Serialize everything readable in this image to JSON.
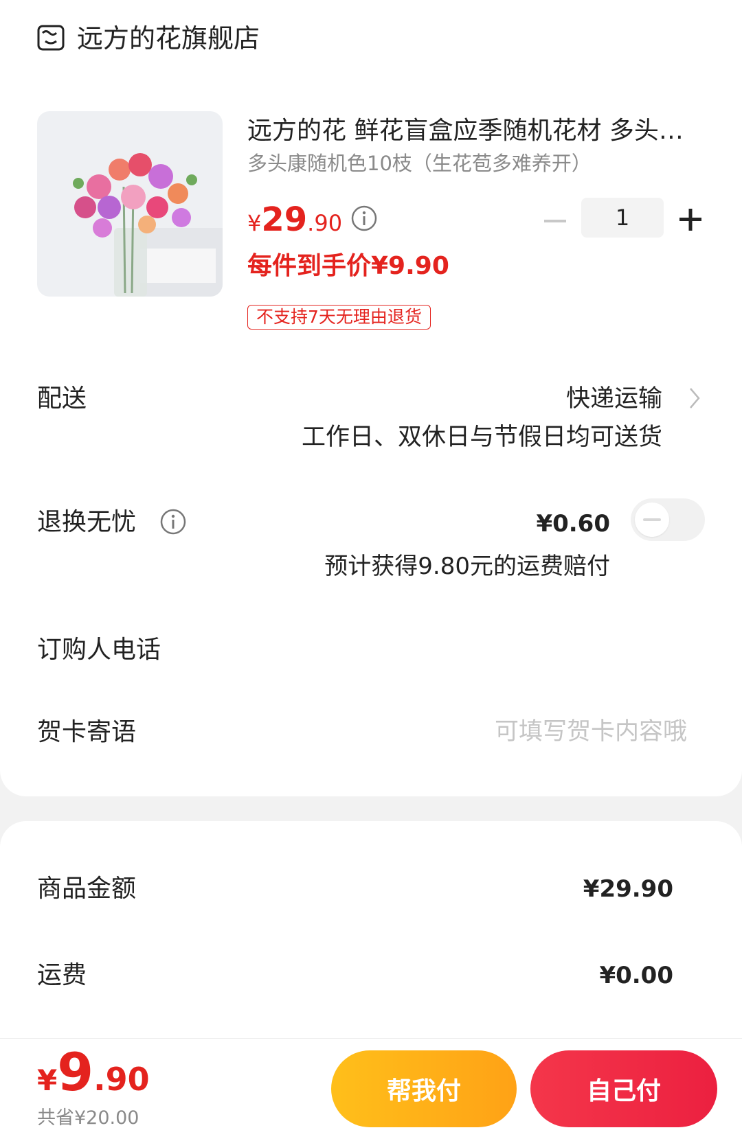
{
  "store": {
    "name": "远方的花旗舰店",
    "icon": "store-icon"
  },
  "product": {
    "title": "远方的花 鲜花盲盒应季随机花材 多头康乃馨",
    "sku": "多头康随机色10枝（生花苞多难养开）",
    "price_currency": "¥",
    "price_int": "29",
    "price_dec": ".90",
    "quantity": "1",
    "unit_price_text": "每件到手价¥9.90",
    "return_tag": "不支持7天无理由退货"
  },
  "delivery": {
    "label": "配送",
    "method": "快递运输",
    "note": "工作日、双休日与节假日均可送货"
  },
  "insurance": {
    "label": "退换无忧",
    "price": "¥0.60",
    "note": "预计获得9.80元的运费赔付",
    "enabled": false
  },
  "phone": {
    "label": "订购人电话"
  },
  "greeting_card": {
    "label": "贺卡寄语",
    "placeholder": "可填写贺卡内容哦"
  },
  "summary": {
    "goods_label": "商品金额",
    "goods_value": "¥29.90",
    "shipping_label": "运费",
    "shipping_value": "¥0.00"
  },
  "footer": {
    "total_currency": "¥",
    "total_int": "9",
    "total_dec": ".90",
    "saved": "共省¥20.00",
    "help_pay": "帮我付",
    "self_pay": "自己付"
  },
  "colors": {
    "accent": "#e4231e",
    "help_button": "#ffb01a",
    "pay_button": "#ef2a44"
  }
}
